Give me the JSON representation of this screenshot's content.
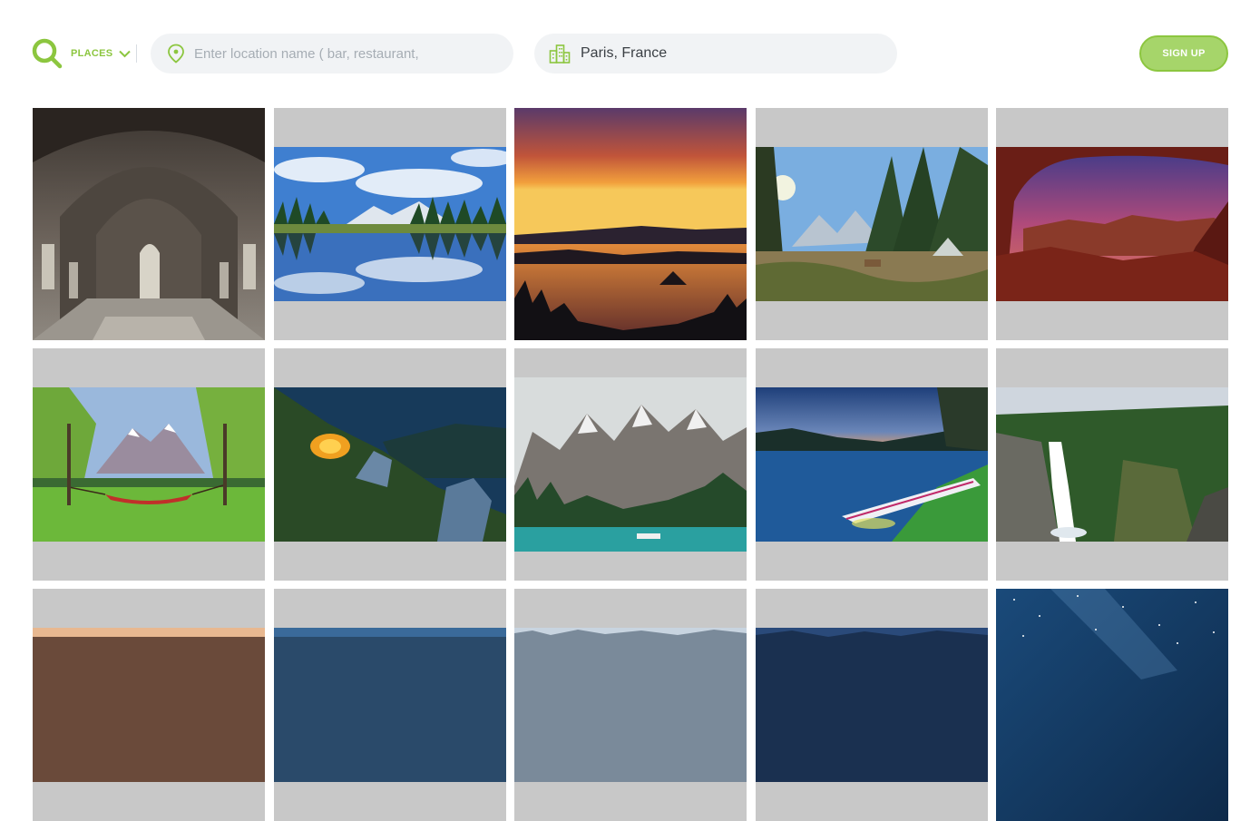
{
  "header": {
    "logo_icon": "search-magnifier-icon",
    "places_label": "PLACES",
    "places_icon": "chevron-down-icon",
    "search": {
      "icon": "map-pin-icon",
      "placeholder": "Enter location name ( bar, restaurant,",
      "value": ""
    },
    "city": {
      "icon": "city-buildings-icon",
      "value": "Paris, France"
    },
    "signup_label": "SIGN UP"
  },
  "colors": {
    "accent": "#8cc63f",
    "accent_light": "#a6d56a",
    "field_bg": "#f1f3f5",
    "tile_placeholder": "#c8c8c8"
  },
  "gallery": {
    "photos": [
      {
        "subject": "abandoned-cathedral"
      },
      {
        "subject": "lake-reflection-clouds"
      },
      {
        "subject": "sunset-lake"
      },
      {
        "subject": "forest-campsite"
      },
      {
        "subject": "red-canyon-arch"
      },
      {
        "subject": "hammock-meadow-mountains"
      },
      {
        "subject": "tent-on-cliff"
      },
      {
        "subject": "mountain-lake-canoe"
      },
      {
        "subject": "kayak-lakeshore"
      },
      {
        "subject": "waterfall-forest"
      },
      {
        "subject": "partial-photo"
      },
      {
        "subject": "partial-photo"
      },
      {
        "subject": "partial-photo"
      },
      {
        "subject": "partial-photo"
      },
      {
        "subject": "starry-night-sky"
      }
    ]
  }
}
